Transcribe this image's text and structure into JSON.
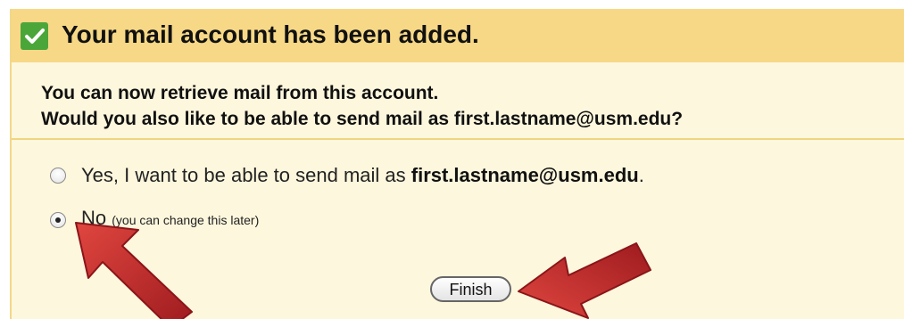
{
  "dialog": {
    "title": "Your mail account has been added.",
    "intro_line1": "You can now retrieve mail from this account.",
    "intro_line2": "Would you also like to be able to send mail as first.lastname@usm.edu?"
  },
  "options": {
    "yes_prefix": "Yes, I want to be able to send mail as ",
    "yes_email": "first.lastname@usm.edu",
    "yes_suffix": ".",
    "yes_selected": false,
    "no_label": "No",
    "no_hint": "(you can change this later)",
    "no_selected": true
  },
  "actions": {
    "finish_label": "Finish"
  },
  "icons": {
    "header_icon": "check-icon",
    "annotation": "red-arrow-icon"
  },
  "colors": {
    "header_bg": "#f7d886",
    "body_bg": "#fdf7dd",
    "check_green": "#4ba63a",
    "arrow_red": "#c1272d"
  }
}
